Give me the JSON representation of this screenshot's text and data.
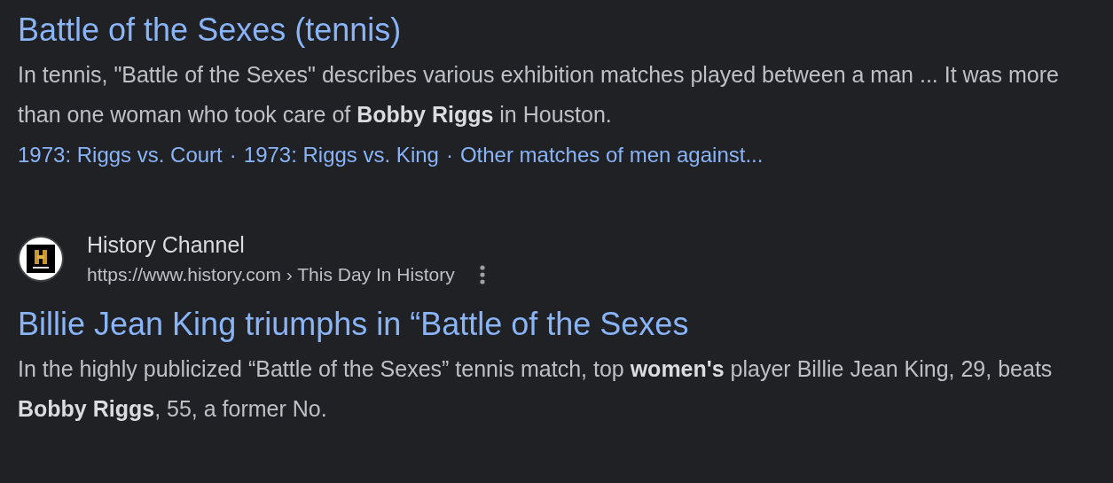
{
  "results": [
    {
      "title": "Battle of the Sexes (tennis)",
      "snippet": "In tennis, \"Battle of the Sexes\" describes various exhibition matches played between a man ... It was more than one woman who took care of **Bobby Riggs** in Houston.",
      "sitelink_separator": "·",
      "sitelinks": [
        "1973: Riggs vs. Court",
        "1973: Riggs vs. King",
        "Other matches of men against..."
      ]
    },
    {
      "source": {
        "name": "History Channel",
        "url": "https://www.history.com",
        "breadcrumb": "› This Day In History"
      },
      "title": "Billie Jean King triumphs in “Battle of the Sexes",
      "snippet": "In the highly publicized “Battle of the Sexes” tennis match, top **women's** player Billie Jean King, 29, beats **Bobby Riggs**, 55, a former No."
    }
  ]
}
